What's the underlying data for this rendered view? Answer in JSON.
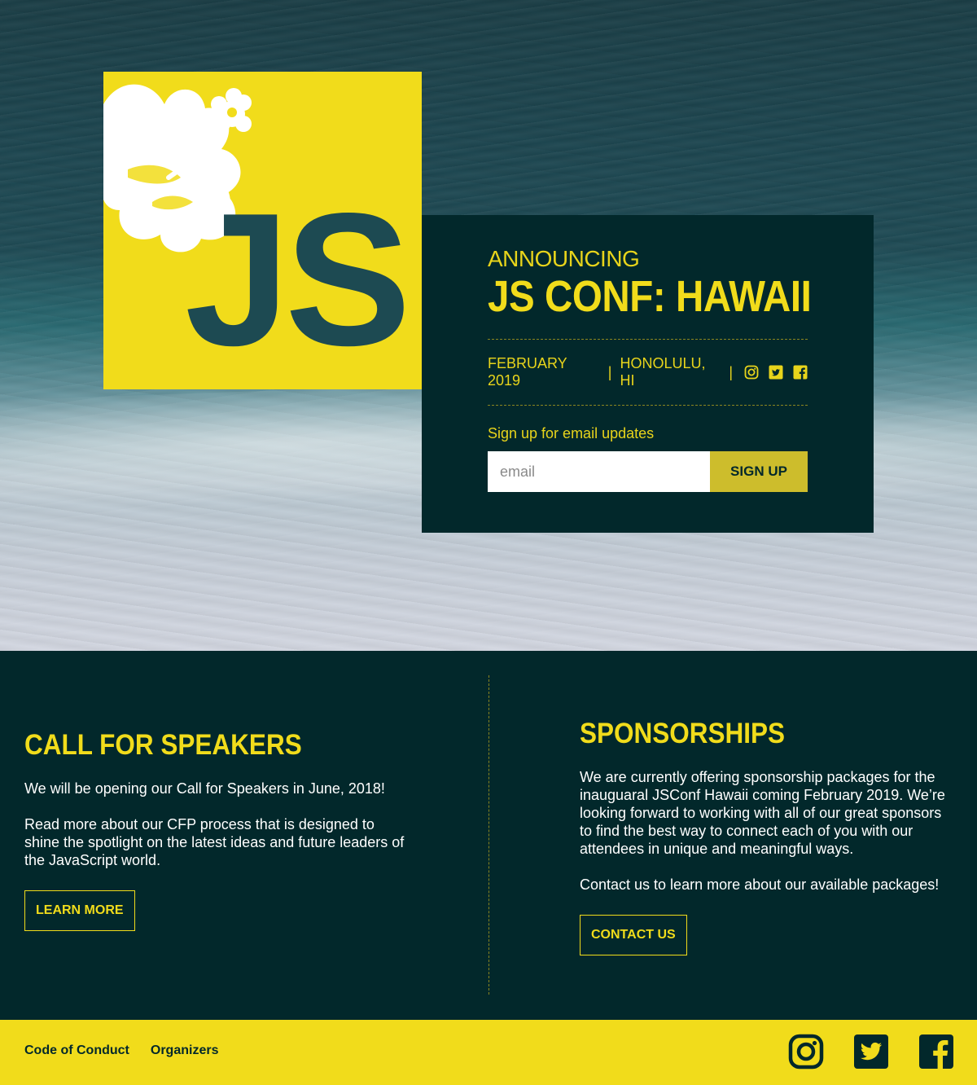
{
  "hero": {
    "logo_text": "JS",
    "announce": {
      "kicker": "ANNOUNCING",
      "title": "JS CONF: HAWAII",
      "date": "FEBRUARY 2019",
      "separator": "|",
      "location": "HONOLULU, HI",
      "social_icons": [
        "instagram-icon",
        "twitter-icon",
        "facebook-icon"
      ]
    },
    "signup": {
      "label": "Sign up for email updates",
      "placeholder": "email",
      "button_label": "SIGN UP"
    }
  },
  "speakers": {
    "title": "CALL FOR SPEAKERS",
    "text1": "We will be opening our Call for Speakers in June, 2018!",
    "text2": "Read more about our CFP process that is designed to shine the spotlight on the latest ideas and future leaders of the JavaScript world.",
    "button_label": "LEARN MORE"
  },
  "sponsorships": {
    "title": "SPONSORSHIPS",
    "text1": "We are currently offering sponsorship packages for the inauguaral JSConf Hawaii coming February 2019. We’re looking forward to working with all of our great sponsors to find the best way to connect each of you with our attendees in unique and meaningful ways.",
    "text2": "Contact us to learn more about our available packages!",
    "button_label": "CONTACT US"
  },
  "footer": {
    "links": [
      "Code of Conduct",
      "Organizers"
    ],
    "social_icons": [
      "instagram-icon",
      "twitter-icon",
      "facebook-icon"
    ]
  },
  "colors": {
    "brand_yellow": "#f1dc1b",
    "dark_teal": "#02282b",
    "button_yellow": "#cdbd2c"
  }
}
